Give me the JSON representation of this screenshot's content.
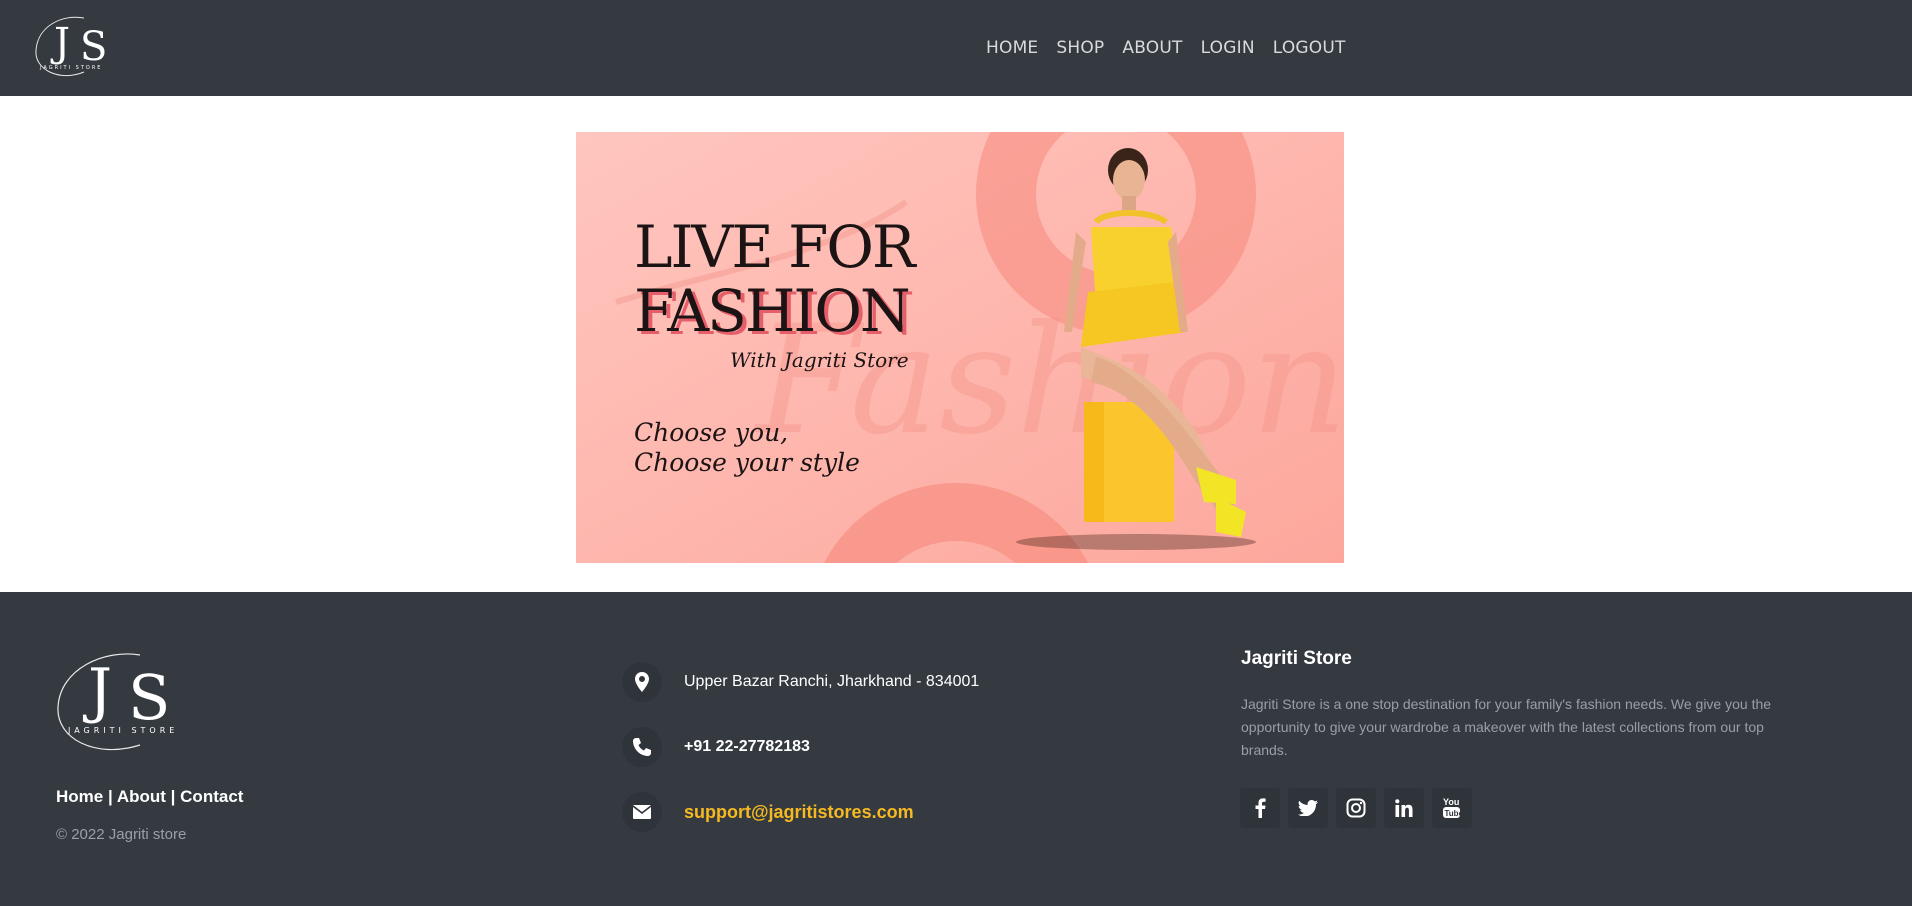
{
  "header": {
    "logo_text": "JS",
    "logo_subtext": "JAGRITI STORE",
    "nav": [
      "HOME",
      "SHOP",
      "ABOUT",
      "LOGIN",
      "LOGOUT"
    ]
  },
  "hero": {
    "title_line1": "LIVE FOR",
    "title_line2": "FASHION",
    "subtitle": "With Jagriti Store",
    "tagline_line1": "Choose you,",
    "tagline_line2": "Choose your style",
    "watermark": "Fashion"
  },
  "footer": {
    "links": [
      "Home",
      "About",
      "Contact"
    ],
    "link_separator": "|",
    "copyright": "© 2022 Jagriti store",
    "address": "Upper Bazar Ranchi, Jharkhand - 834001",
    "phone": "+91 22-27782183",
    "email": "support@jagritistores.com",
    "about_title": "Jagriti Store",
    "about_text": "Jagriti Store is a one stop destination for your family's fashion needs. We give you the opportunity to give your wardrobe a makeover with the latest collections from our top brands.",
    "social_icons": [
      "facebook-icon",
      "twitter-icon",
      "instagram-icon",
      "linkedin-icon",
      "youtube-icon"
    ]
  },
  "colors": {
    "dark_bg": "#343a40",
    "accent": "#f5b921",
    "hero_bg": "#fdbfb7"
  }
}
